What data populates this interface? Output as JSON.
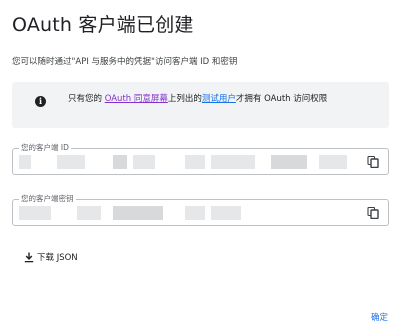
{
  "dialog": {
    "title": "OAuth 客户端已创建",
    "description": "您可以随时通过\"API 与服务中的凭据\"访问客户端 ID 和密钥"
  },
  "notice": {
    "icon": "info-icon",
    "prefix": "只有您的 ",
    "link1": "OAuth 同意屏幕",
    "middle": "上列出的",
    "link2": "测试用户",
    "suffix": "才拥有 OAuth 访问权限"
  },
  "client_id": {
    "label": "您的客户端 ID",
    "value": "",
    "copy_icon": "copy-icon"
  },
  "client_secret": {
    "label": "您的客户端密钥",
    "value": "",
    "copy_icon": "copy-icon"
  },
  "download": {
    "icon": "download-icon",
    "label": "下载 JSON"
  },
  "actions": {
    "confirm_label": "确定"
  },
  "colors": {
    "accent": "#1a73e8",
    "visited_link": "#8430ce",
    "notice_bg": "#f1f3f4"
  }
}
